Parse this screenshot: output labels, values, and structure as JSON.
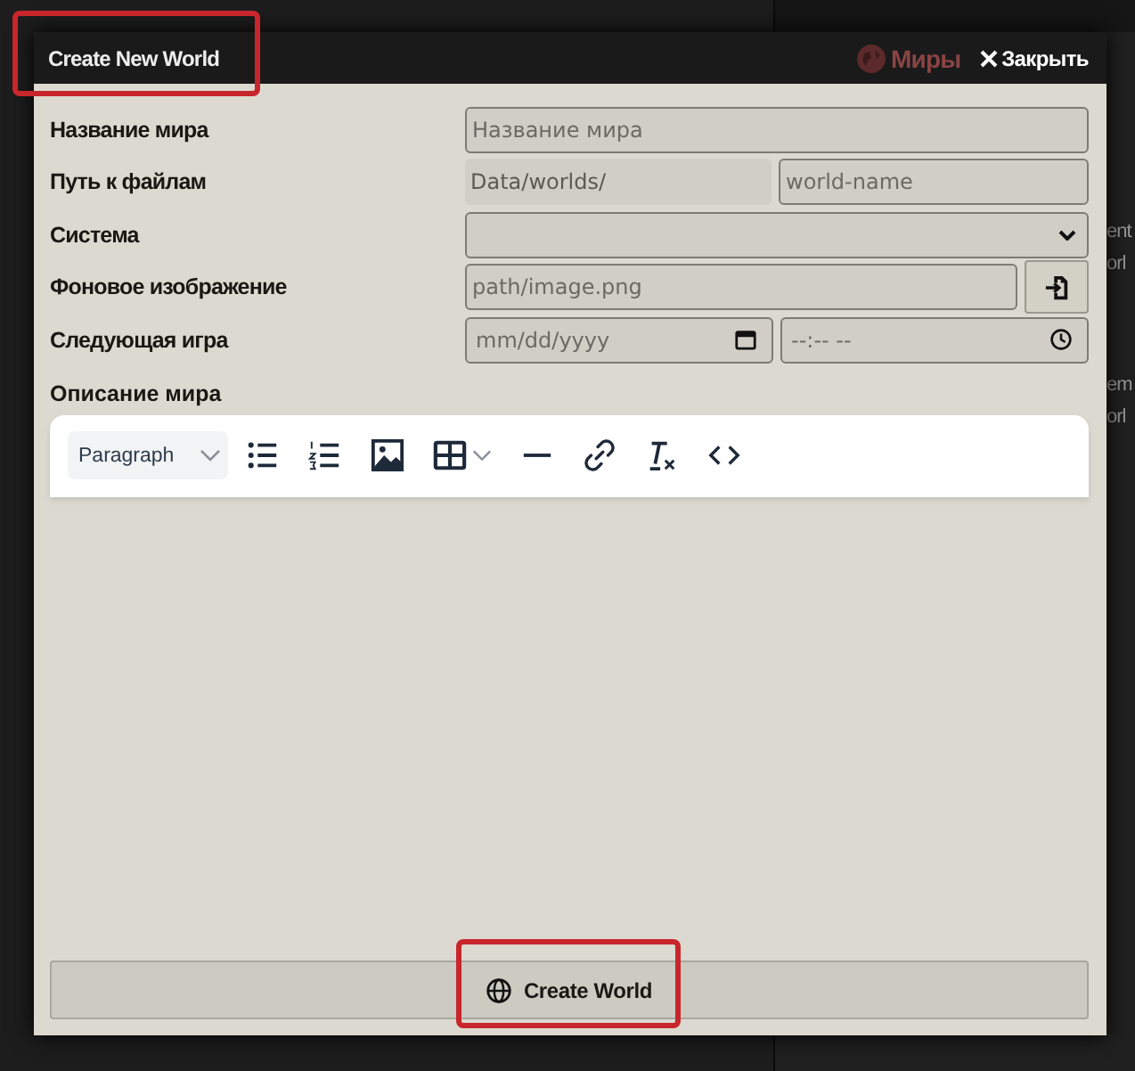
{
  "background": {
    "panel_title": "Миры",
    "edge_texts": [
      "ent",
      "orl",
      "em",
      "orl"
    ]
  },
  "dialog": {
    "title": "Create New World",
    "close": "Закрыть",
    "fields": [
      {
        "kind": "text",
        "label": "Название мира",
        "placeholder": "Название мира"
      },
      {
        "kind": "path",
        "label": "Путь к файлам",
        "prefix": "Data/worlds/",
        "placeholder": "world-name"
      },
      {
        "kind": "select",
        "label": "Система"
      },
      {
        "kind": "file",
        "label": "Фоновое изображение",
        "placeholder": "path/image.png"
      },
      {
        "kind": "datetime",
        "label": "Следующая игра",
        "date_placeholder": "mm/dd/yyyy",
        "time_placeholder": "--:-- --"
      }
    ],
    "description_label": "Описание мира",
    "editor": {
      "format": "Paragraph"
    },
    "submit": "Create World"
  }
}
